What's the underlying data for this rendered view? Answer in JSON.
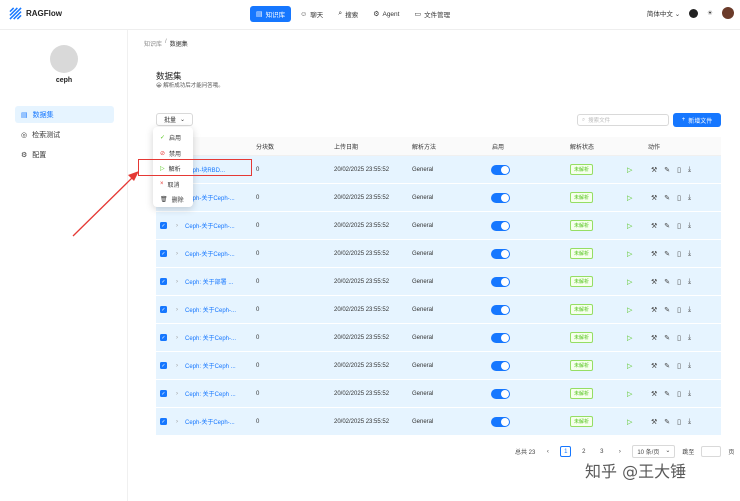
{
  "app": {
    "name": "RAGFlow"
  },
  "nav": [
    {
      "label": "知识库",
      "icon": "knowledge-icon",
      "active": true
    },
    {
      "label": "聊天",
      "icon": "chat-icon",
      "active": false
    },
    {
      "label": "搜索",
      "icon": "search-icon",
      "active": false
    },
    {
      "label": "Agent",
      "icon": "agent-icon",
      "active": false
    },
    {
      "label": "文件管理",
      "icon": "folder-icon",
      "active": false
    }
  ],
  "top_right": {
    "language": "简体中文"
  },
  "sidebar": {
    "user_name": "ceph",
    "items": [
      {
        "label": "数据集",
        "icon": "dataset-icon",
        "active": true
      },
      {
        "label": "检索测试",
        "icon": "retrieval-icon",
        "active": false
      },
      {
        "label": "配置",
        "icon": "gear-icon",
        "active": false
      }
    ]
  },
  "breadcrumb": {
    "parent": "知识库",
    "sep": "/",
    "current": "数据集"
  },
  "page": {
    "title": "数据集",
    "subtitle": "解析成功后才能问答哦。"
  },
  "toolbar": {
    "batch_label": "批量",
    "search_placeholder": "搜索文件",
    "add_label": "新增文件"
  },
  "dropdown": [
    {
      "label": "启用",
      "icon": "check-icon"
    },
    {
      "label": "禁用",
      "icon": "disable-icon"
    },
    {
      "label": "解析",
      "icon": "play-icon"
    },
    {
      "label": "取消",
      "icon": "close-icon"
    },
    {
      "label": "删除",
      "icon": "trash-icon"
    }
  ],
  "table": {
    "headers": {
      "chunks": "分块数",
      "upload_date": "上传日期",
      "parser": "解析方法",
      "enabled": "启用",
      "parse_status": "解析状态",
      "actions": "动作"
    },
    "rows": [
      {
        "name": "Ceph-块RBD...",
        "chunks": "0",
        "date": "20/02/2025 23:55:52",
        "parser": "General",
        "status": "未解析"
      },
      {
        "name": "Ceph-关于Ceph-...",
        "chunks": "0",
        "date": "20/02/2025 23:55:52",
        "parser": "General",
        "status": "未解析"
      },
      {
        "name": "Ceph-关于Ceph-...",
        "chunks": "0",
        "date": "20/02/2025 23:55:52",
        "parser": "General",
        "status": "未解析"
      },
      {
        "name": "Ceph-关于Ceph-...",
        "chunks": "0",
        "date": "20/02/2025 23:55:52",
        "parser": "General",
        "status": "未解析"
      },
      {
        "name": "Ceph: 关于部署 ...",
        "chunks": "0",
        "date": "20/02/2025 23:55:52",
        "parser": "General",
        "status": "未解析"
      },
      {
        "name": "Ceph: 关于Ceph-...",
        "chunks": "0",
        "date": "20/02/2025 23:55:52",
        "parser": "General",
        "status": "未解析"
      },
      {
        "name": "Ceph: 关于Ceph-...",
        "chunks": "0",
        "date": "20/02/2025 23:55:52",
        "parser": "General",
        "status": "未解析"
      },
      {
        "name": "Ceph: 关于Ceph ...",
        "chunks": "0",
        "date": "20/02/2025 23:55:52",
        "parser": "General",
        "status": "未解析"
      },
      {
        "name": "Ceph: 关于Ceph ...",
        "chunks": "0",
        "date": "20/02/2025 23:55:52",
        "parser": "General",
        "status": "未解析"
      },
      {
        "name": "Ceph-关于Ceph-...",
        "chunks": "0",
        "date": "20/02/2025 23:55:52",
        "parser": "General",
        "status": "未解析"
      }
    ]
  },
  "pagination": {
    "total": "总共 23",
    "pages": [
      "1",
      "2",
      "3"
    ],
    "current": "1",
    "page_size": "10 条/页",
    "jump_label": "跳至",
    "page_suffix": "页"
  },
  "watermark": "知乎 @王大锤",
  "colors": {
    "primary": "#1677ff",
    "row_bg": "#e6f4ff",
    "highlight": "#e53935",
    "success": "#52c41a"
  }
}
